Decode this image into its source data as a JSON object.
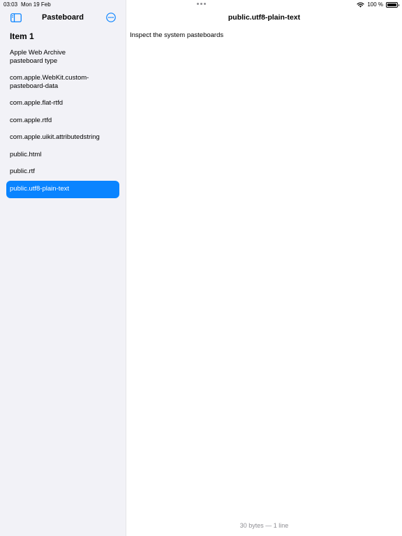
{
  "status_bar": {
    "time": "03:03",
    "date": "Mon 19 Feb",
    "battery": "100 %"
  },
  "sidebar": {
    "title": "Pasteboard",
    "section_heading": "Item 1",
    "toggle_icon": "sidebar-toggle-icon",
    "more_icon": "ellipsis-circle-icon",
    "items": [
      {
        "label": "Apple Web Archive\npasteboard type",
        "selected": false
      },
      {
        "label": "com.apple.WebKit.custom-\npasteboard-data",
        "selected": false
      },
      {
        "label": "com.apple.flat-rtfd",
        "selected": false
      },
      {
        "label": "com.apple.rtfd",
        "selected": false
      },
      {
        "label": "com.apple.uikit.attributedstring",
        "selected": false
      },
      {
        "label": "public.html",
        "selected": false
      },
      {
        "label": "public.rtf",
        "selected": false
      },
      {
        "label": "public.utf8-plain-text",
        "selected": true
      }
    ]
  },
  "detail": {
    "title": "public.utf8-plain-text",
    "content": "Inspect the system pasteboards",
    "footer": "30 bytes — 1 line"
  },
  "colors": {
    "accent": "#0a84ff",
    "sidebar_bg": "#f2f2f7",
    "secondary_text": "#8e8e93"
  }
}
